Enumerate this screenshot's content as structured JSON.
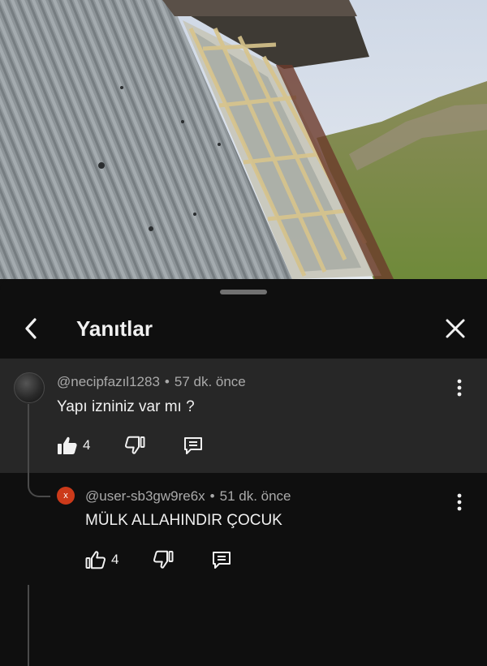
{
  "panel": {
    "title": "Yanıtlar",
    "back_icon": "chevron-left-icon",
    "close_icon": "close-icon"
  },
  "comments": [
    {
      "author": "@necipfazıl1283",
      "time": "57 dk. önce",
      "text": "Yapı izniniz var mı ?",
      "likes": "4"
    },
    {
      "author": "@user-sb3gw9re6x",
      "time": "51 dk. önce",
      "text": "MÜLK ALLAHINDIR ÇOCUK",
      "likes": "4",
      "avatar_letter": "x",
      "avatar_color": "#cc3a1a"
    }
  ],
  "colors": {
    "background": "#0f0f0f",
    "highlight_row": "#272727",
    "meta_text": "#aaaaaa"
  }
}
